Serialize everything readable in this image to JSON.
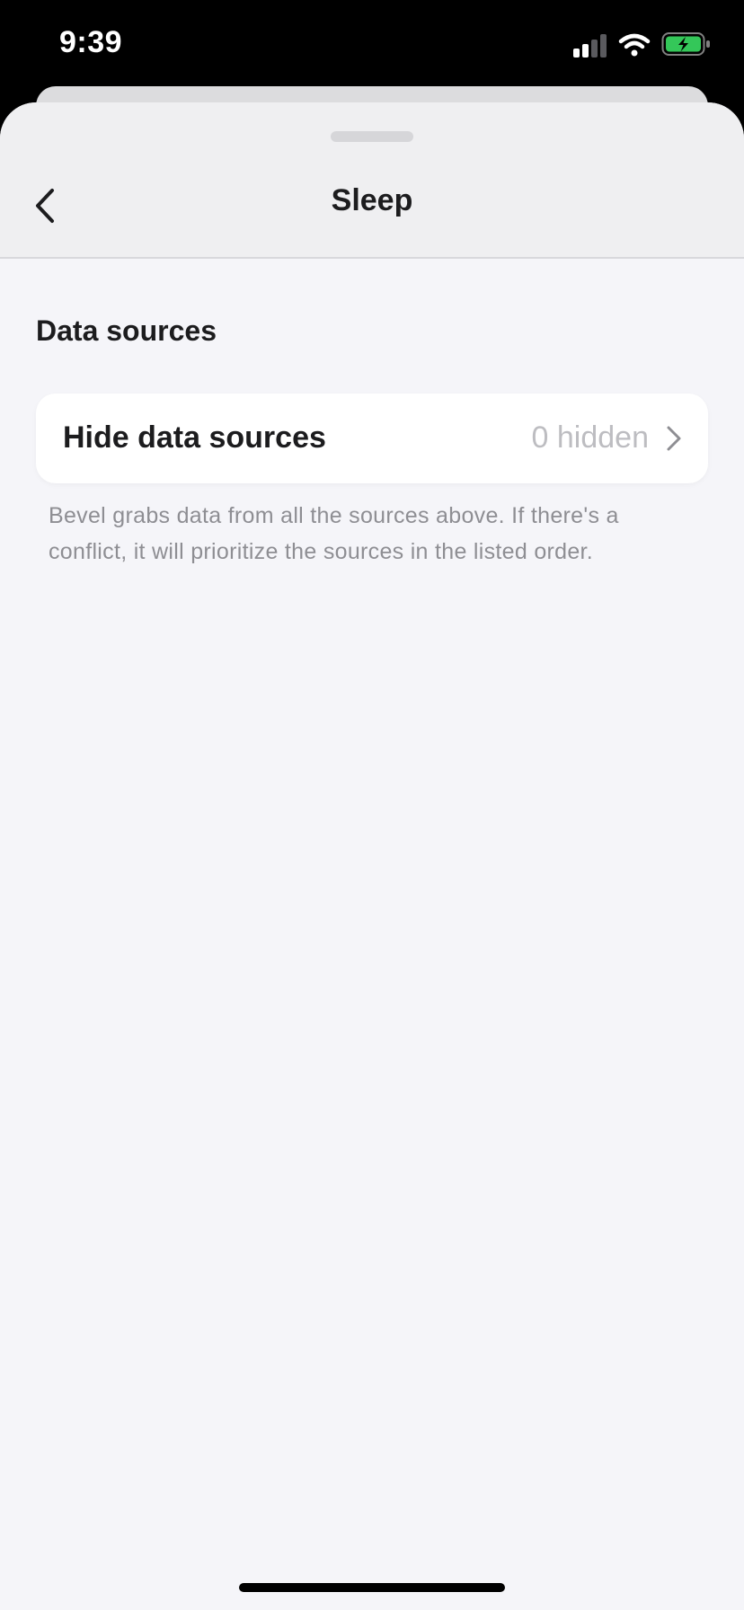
{
  "status_bar": {
    "time": "9:39",
    "icons": [
      "signal-icon",
      "wifi-icon",
      "battery-charging-icon"
    ],
    "battery_color": "#34c759"
  },
  "sheet": {
    "title": "Sleep",
    "back_icon": "chevron-left-icon"
  },
  "section": {
    "title": "Data sources",
    "row": {
      "label": "Hide data sources",
      "value": "0 hidden",
      "icon": "chevron-right-icon"
    },
    "footnote": "Bevel grabs data from all the sources above. If there's a conflict, it will prioritize the sources in the listed order."
  }
}
